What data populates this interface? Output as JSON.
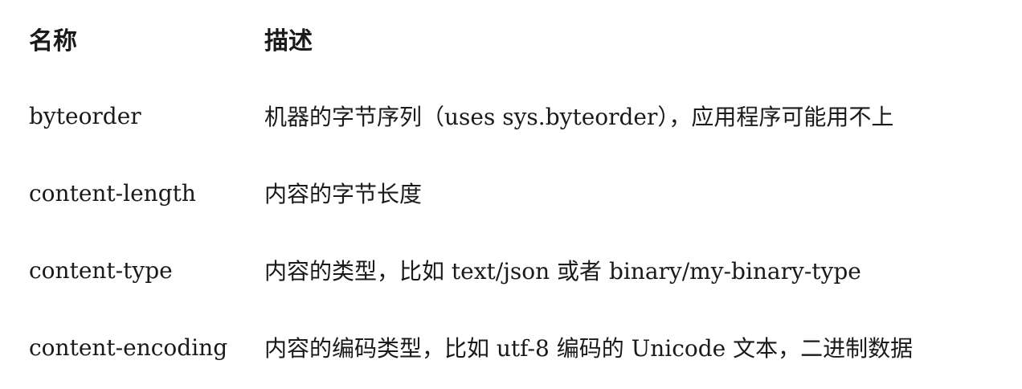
{
  "header": {
    "name": "名称",
    "description": "描述"
  },
  "rows": [
    {
      "name": "byteorder",
      "description": "机器的字节序列（uses sys.byteorder），应用程序可能用不上"
    },
    {
      "name": "content-length",
      "description": "内容的字节长度"
    },
    {
      "name": "content-type",
      "description": "内容的类型，比如 text/json 或者 binary/my-binary-type"
    },
    {
      "name": "content-encoding",
      "description": "内容的编码类型，比如 utf-8 编码的 Unicode 文本，二进制数据"
    }
  ]
}
